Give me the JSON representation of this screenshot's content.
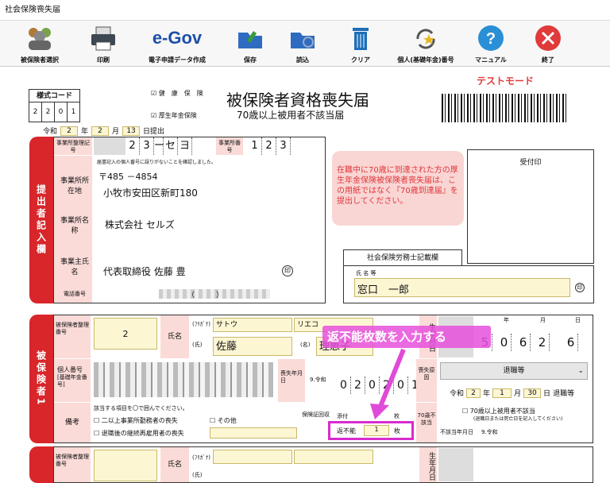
{
  "window": {
    "title": "社会保険喪失届"
  },
  "toolbar": [
    {
      "label": "被保険者選択",
      "icon": "people-icon"
    },
    {
      "label": "印刷",
      "icon": "printer-icon"
    },
    {
      "label": "電子申請データ作成",
      "icon": "egov-logo",
      "logo": "e-Gov"
    },
    {
      "label": "保存",
      "icon": "folder-save-icon"
    },
    {
      "label": "読込",
      "icon": "folder-load-icon"
    },
    {
      "label": "クリア",
      "icon": "trash-icon"
    },
    {
      "label": "個人(基礎年金)番号",
      "icon": "refresh-star-icon"
    },
    {
      "label": "マニュアル",
      "icon": "help-icon"
    },
    {
      "label": "終了",
      "icon": "close-icon"
    }
  ],
  "form": {
    "code_title": "様式コード",
    "code_digits": [
      "2",
      "2",
      "0",
      "1"
    ],
    "chk1": "健　康　保　険",
    "chk2": "厚生年金保険",
    "title": "被保険者資格喪失届",
    "subtitle": "70歳以上被用者不該当届",
    "mode": "テストモード",
    "date": {
      "era": "令和",
      "year": "2",
      "y": "年",
      "month": "2",
      "m": "月",
      "day": "13",
      "d": "日提出"
    },
    "office_code_label": "事業所整理記号",
    "office_code": [
      "2",
      "3",
      "ー",
      "セ",
      "ヨ"
    ],
    "office_no_label": "事業所番号",
    "office_no": [
      "1",
      "2",
      "3"
    ],
    "confirm_note": "届書記入の個人番号に誤りがないことを確認しました。",
    "addr_label": "事業所所在地",
    "postal": "〒485 －4854",
    "address": "小牧市安田区新町180",
    "name_label": "事業所名称",
    "office_name": "株式会社 セルズ",
    "owner_label": "事業主氏名",
    "owner": "代表取締役 佐藤 豊",
    "seal": "印",
    "phone_label": "電話番号",
    "phone_paren": "（　　　）",
    "side_label": "提出者記入欄",
    "notice": "在職中に70歳に到達された方の厚生年金保険被保険者喪失届は、この用紙ではなく『70歳到達届』を提出してください。",
    "receipt": "受付印",
    "sharoushi": "社会保険労務士記載欄",
    "shimei": "氏 名 等",
    "sharoushi_name": "窓口　一郎",
    "ins_side": "被保険者1",
    "ins_no_label": "被保険者整理番号",
    "ins_no": "2",
    "kana_label": "(ﾌﾘｶﾞﾅ)",
    "name_col": "氏名",
    "kana_sei": "サトウ",
    "kana_mei": "リエコ",
    "sei_label": "(氏)",
    "mei_label": "(名)",
    "sei": "佐藤",
    "mei": "理恵子",
    "birth_label": "生年月日",
    "birth": [
      "5",
      "0",
      "6",
      "2",
      "6"
    ],
    "birth_units": [
      "年",
      "月",
      "日"
    ],
    "annot": "返不能枚数を入力する",
    "mynum_label": "個人番号",
    "basic_label": "[基礎年金番号]",
    "loss_label": "喪失年月日",
    "loss_era": "9.令和",
    "loss_digits": [
      "0",
      "2",
      "0",
      "2",
      "0",
      "1"
    ],
    "reason_label": "喪失原因",
    "reason": "退職等",
    "reason_date": {
      "era": "令和",
      "y": "2",
      "m": "1",
      "d": "30",
      "after": "退職等"
    },
    "memo_label": "備考",
    "memo_note": "該当する項目を〇で囲んでください。",
    "memo1": "二以上事業所勤務者の喪失",
    "memo2": "退職後の継続再雇用者の喪失",
    "memo3": "その他",
    "cert_label": "保険証回収",
    "attach": "添付",
    "count": "枚",
    "unreturn": "返不能",
    "unreturn_count": "1",
    "over70": "70歳不該当",
    "over70_chk": "70歳以上被用者不該当",
    "over70_note": "(退職日または死亡日を記入してください)",
    "not_date": "不該当年月日",
    "not_era": "9.令和",
    "ins2_no_label": "被保険者整理番号",
    "birth2_label": "生年月日"
  }
}
